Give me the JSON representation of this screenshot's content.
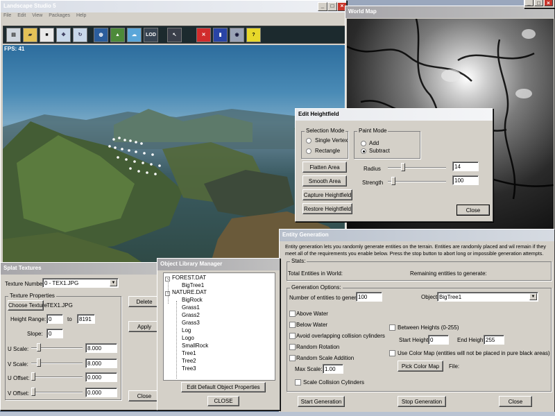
{
  "main_window": {
    "title": "Landscape Studio 5",
    "menu": [
      "File",
      "Edit",
      "View",
      "Packages",
      "Help"
    ],
    "fps": "FPS: 41",
    "toolbar": [
      "new-icon",
      "open-icon",
      "save-icon",
      "move-icon",
      "rotate-icon",
      "globe-icon",
      "terrain-icon",
      "sky-icon",
      "LOD",
      "cursor-icon",
      "stop-icon",
      "book-icon",
      "eye-icon",
      "help-icon"
    ],
    "lod_label": "LOD",
    "help_label": "?"
  },
  "world_map": {
    "title": "World Map"
  },
  "edit_heightfield": {
    "title": "Edit Heightfield",
    "selection_mode": "Selection Mode",
    "single_vertex": "Single Vertex",
    "rectangle": "Rectangle",
    "paint_mode": "Paint Mode",
    "add": "Add",
    "subtract": "Subtract",
    "flatten_area": "Flatten Area",
    "smooth_area": "Smooth Area",
    "capture_heightfield": "Capture Heightfield",
    "restore_heightfield": "Restore Heightfield",
    "radius_label": "Radius",
    "radius_value": "14",
    "radius_level": 0.22,
    "strength_label": "Strength",
    "strength_value": "100",
    "strength_level": 0.06,
    "close": "Close"
  },
  "entity_generation": {
    "title": "Entity Generation",
    "description": "Entity generation lets you randomly generate entities on the terrain.  Entities are randomly placed and wil remain if they meet all of the requirements you enable below.  Press the stop button to abort long or impossible generation attempts.",
    "stats_label": "Stats:",
    "total_entities": "Total Entities in World:",
    "remaining": "Remaining entities to generate:",
    "options_label": "Generation Options:",
    "num_label": "Number of entities to generate:",
    "num_value": "100",
    "object_label": "Object:",
    "object_value": "BigTree1",
    "above_water": "Above Water",
    "below_water": "Below Water",
    "avoid_collision": "Avoid overlapping collision cylinders",
    "random_rotation": "Random Rotation",
    "random_scale": "Random Scale Addition",
    "max_scale_label": "Max Scale:",
    "max_scale_value": "1.00",
    "scale_collision": "Scale Collision Cylinders",
    "between_heights": "Between Heights (0-255)",
    "start_height_label": "Start Height",
    "start_height_value": "0",
    "end_height_label": "End Height",
    "end_height_value": "255",
    "use_color_map": "Use Color Map (entities will not be placed in pure black areas)",
    "pick_color_map": "Pick Color Map",
    "file_label": "File:",
    "start_generation": "Start Generation",
    "stop_generation": "Stop Generation",
    "close": "Close"
  },
  "splat_textures": {
    "title": "Splat Textures",
    "texture_number_label": "Texture Number:",
    "texture_number_value": "0 - TEX1.JPG",
    "texture_properties": "Texture Properties",
    "choose_texture": "Choose Texture",
    "texture_file": "TEX1.JPG",
    "height_range_label": "Height Range:",
    "height_from": "0",
    "to_label": "to",
    "height_to": "8191",
    "slope_label": "Slope:",
    "slope_value": "0",
    "u_scale_label": "U Scale:",
    "u_scale_value": "8.000",
    "v_scale_label": "V Scale:",
    "v_scale_value": "8.000",
    "u_offset_label": "U Offset:",
    "u_offset_value": "0.000",
    "v_offset_label": "V Offset:",
    "v_offset_value": "0.000",
    "delete": "Delete",
    "apply": "Apply",
    "close": "Close"
  },
  "object_library": {
    "title": "Object Library Manager",
    "tree": [
      {
        "label": "FOREST.DAT",
        "level": 0
      },
      {
        "label": "BigTree1",
        "level": 1
      },
      {
        "label": "NATURE.DAT",
        "level": 0
      },
      {
        "label": "BigRock",
        "level": 1
      },
      {
        "label": "Grass1",
        "level": 1
      },
      {
        "label": "Grass2",
        "level": 1
      },
      {
        "label": "Grass3",
        "level": 1
      },
      {
        "label": "Log",
        "level": 1
      },
      {
        "label": "Logo",
        "level": 1
      },
      {
        "label": "SmallRock",
        "level": 1
      },
      {
        "label": "Tree1",
        "level": 1
      },
      {
        "label": "Tree2",
        "level": 1
      },
      {
        "label": "Tree3",
        "level": 1
      }
    ],
    "edit_default": "Edit Default Object Properties",
    "close": "CLOSE"
  },
  "colors": {
    "window_bg": "#d4d0c8",
    "selection": "#0a246a"
  }
}
